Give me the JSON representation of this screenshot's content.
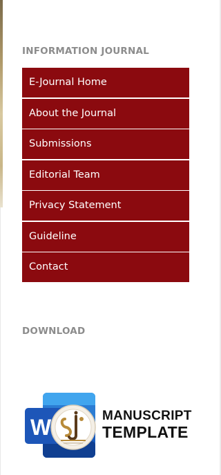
{
  "sidebar": {
    "info_title": "INFORMATION JOURNAL",
    "menu": [
      {
        "label": "E-Journal Home"
      },
      {
        "label": "About the Journal"
      },
      {
        "label": "Submissions"
      },
      {
        "label": "Editorial Team"
      },
      {
        "label": "Privacy Statement"
      },
      {
        "label": "Guideline"
      },
      {
        "label": "Contact"
      }
    ],
    "download_title": "DOWNLOAD",
    "template_banner": {
      "icon": "word-document-icon",
      "logo_letter": "W",
      "line1": "MANUSCRIPT",
      "line2": "TEMPLATE"
    }
  },
  "colors": {
    "menu_bg": "#8b0a0f",
    "menu_text": "#ffffff",
    "section_title": "#8c8c8c",
    "word_blue": "#185abd"
  }
}
